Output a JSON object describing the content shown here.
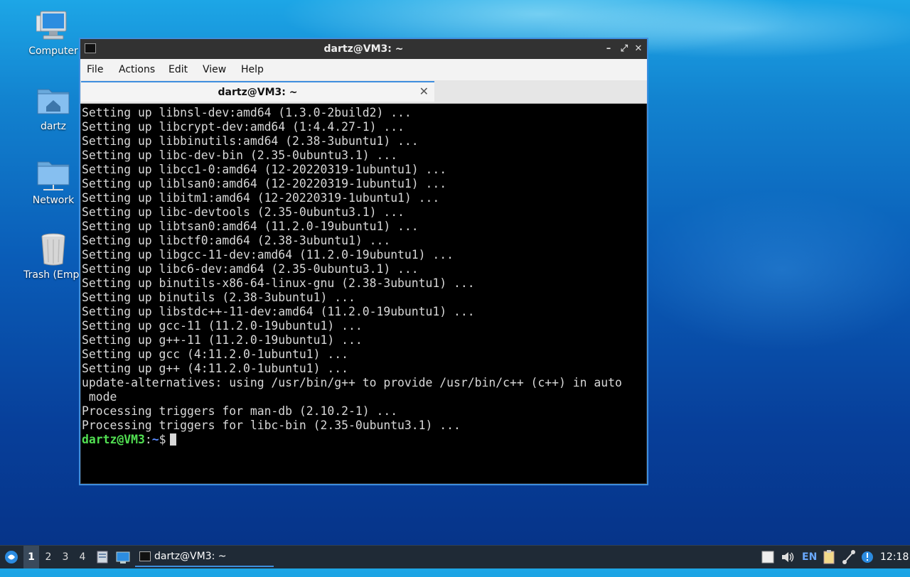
{
  "desktop": {
    "icons": [
      {
        "label": "Computer",
        "icon": "computer-icon"
      },
      {
        "label": "dartz",
        "icon": "home-folder-icon"
      },
      {
        "label": "Network",
        "icon": "network-folder-icon"
      },
      {
        "label": "Trash (Empt",
        "icon": "trash-icon"
      }
    ]
  },
  "window": {
    "title": "dartz@VM3: ~",
    "controls": {
      "minimize": "–",
      "maximize": "⤢",
      "close": "✕"
    },
    "menu": [
      "File",
      "Actions",
      "Edit",
      "View",
      "Help"
    ],
    "tab": {
      "label": "dartz@VM3: ~",
      "close": "✕"
    }
  },
  "terminal": {
    "lines": [
      "Setting up libnsl-dev:amd64 (1.3.0-2build2) ...",
      "Setting up libcrypt-dev:amd64 (1:4.4.27-1) ...",
      "Setting up libbinutils:amd64 (2.38-3ubuntu1) ...",
      "Setting up libc-dev-bin (2.35-0ubuntu3.1) ...",
      "Setting up libcc1-0:amd64 (12-20220319-1ubuntu1) ...",
      "Setting up liblsan0:amd64 (12-20220319-1ubuntu1) ...",
      "Setting up libitm1:amd64 (12-20220319-1ubuntu1) ...",
      "Setting up libc-devtools (2.35-0ubuntu3.1) ...",
      "Setting up libtsan0:amd64 (11.2.0-19ubuntu1) ...",
      "Setting up libctf0:amd64 (2.38-3ubuntu1) ...",
      "Setting up libgcc-11-dev:amd64 (11.2.0-19ubuntu1) ...",
      "Setting up libc6-dev:amd64 (2.35-0ubuntu3.1) ...",
      "Setting up binutils-x86-64-linux-gnu (2.38-3ubuntu1) ...",
      "Setting up binutils (2.38-3ubuntu1) ...",
      "Setting up libstdc++-11-dev:amd64 (11.2.0-19ubuntu1) ...",
      "Setting up gcc-11 (11.2.0-19ubuntu1) ...",
      "Setting up g++-11 (11.2.0-19ubuntu1) ...",
      "Setting up gcc (4:11.2.0-1ubuntu1) ...",
      "Setting up g++ (4:11.2.0-1ubuntu1) ...",
      "update-alternatives: using /usr/bin/g++ to provide /usr/bin/c++ (c++) in auto",
      " mode",
      "Processing triggers for man-db (2.10.2-1) ...",
      "Processing triggers for libc-bin (2.35-0ubuntu3.1) ..."
    ],
    "prompt_user": "dartz@VM3",
    "prompt_sep": ":",
    "prompt_path": "~",
    "prompt_symbol": "$"
  },
  "taskbar": {
    "workspaces": [
      "1",
      "2",
      "3",
      "4"
    ],
    "active_workspace": "1",
    "task_label": "dartz@VM3: ~",
    "keyboard_layout": "EN",
    "clock": "12:18",
    "accent": "#3e8ede"
  }
}
